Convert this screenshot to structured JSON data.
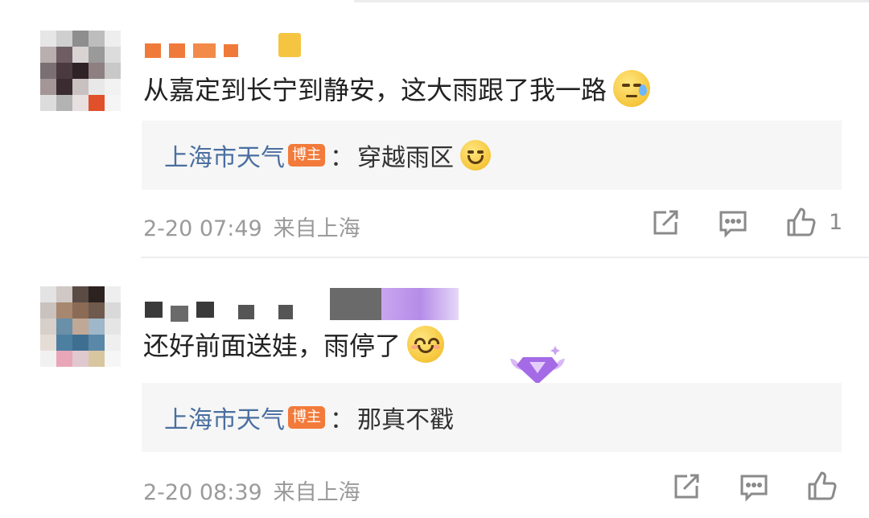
{
  "colors": {
    "reply_name": "#4a6fa0",
    "badge_bg": "#f27a3a",
    "reply_bg": "#f6f6f6",
    "meta_text": "#9a9a9a",
    "body_text": "#222222"
  },
  "comments": [
    {
      "text": "从嘉定到长宁到静安，这大雨跟了我一路",
      "emoji_icon": "sleepy-sweat-emoji-icon",
      "reply": {
        "name": "上海市天气",
        "badge": "博主",
        "colon": "：",
        "text": "穿越雨区",
        "emoji_icon": "laugh-cry-emoji-icon"
      },
      "time": "2-20 07:49",
      "source": "来自上海",
      "like_count": "1"
    },
    {
      "text": "还好前面送娃，雨停了",
      "emoji_icon": "smile-emoji-icon",
      "badge_icon": "purple-gem-badge-icon",
      "reply": {
        "name": "上海市天气",
        "badge": "博主",
        "colon": "：",
        "text": "那真不戳"
      },
      "time": "2-20 08:39",
      "source": "来自上海",
      "like_count": ""
    }
  ],
  "actions": [
    "repost-icon",
    "comment-icon",
    "like-icon"
  ]
}
